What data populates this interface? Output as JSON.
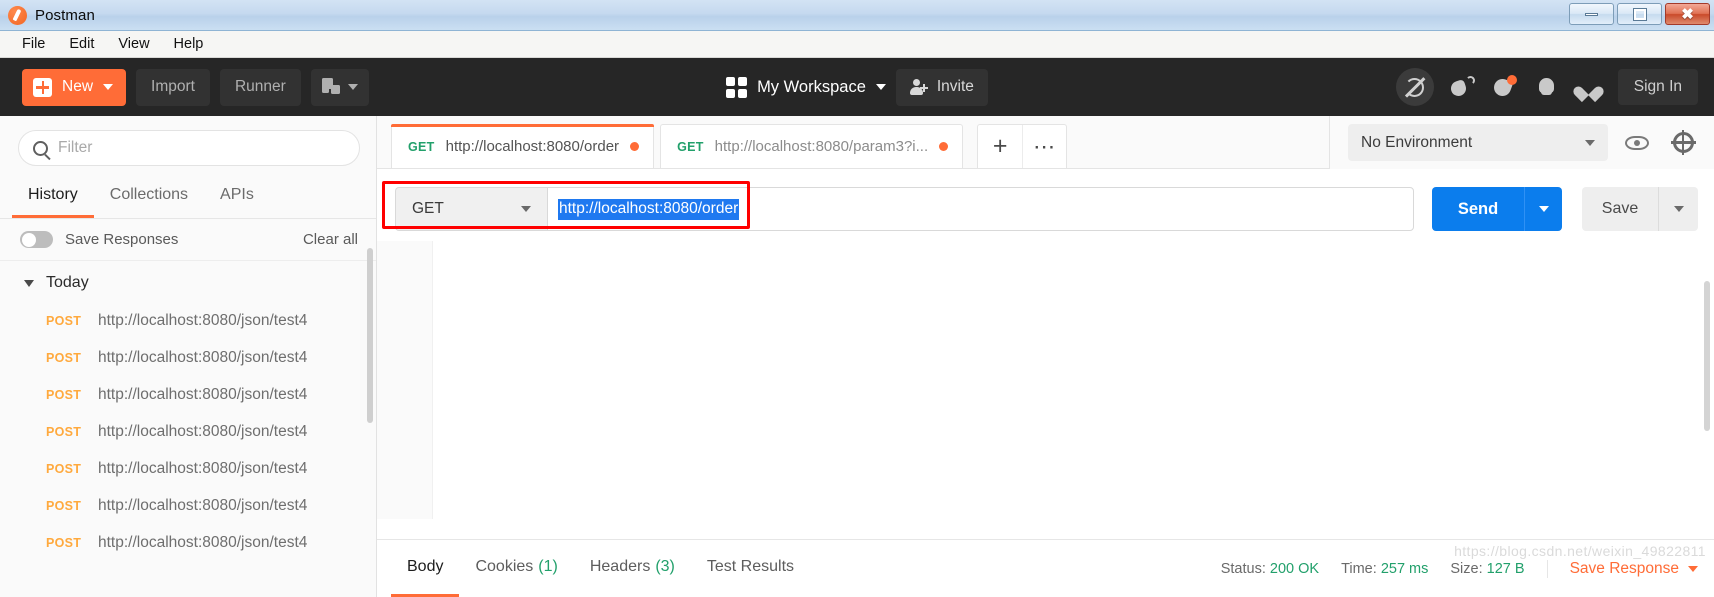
{
  "window": {
    "title": "Postman",
    "logo_icon": "postman-logo-icon",
    "minimize_icon": "minimize-icon",
    "maximize_icon": "maximize-icon",
    "close_icon": "close-icon"
  },
  "menubar": {
    "items": [
      {
        "label": "File"
      },
      {
        "label": "Edit"
      },
      {
        "label": "View"
      },
      {
        "label": "Help"
      }
    ]
  },
  "toolbar": {
    "new_label": "New",
    "new_icon": "plus-square-icon",
    "new_caret_icon": "chevron-down-icon",
    "import_label": "Import",
    "runner_label": "Runner",
    "open_new_icon": "new-window-icon",
    "open_new_caret_icon": "chevron-down-icon",
    "workspace_icon": "grid-icon",
    "workspace_label": "My Workspace",
    "workspace_caret_icon": "chevron-down-icon",
    "invite_label": "Invite",
    "invite_icon": "person-plus-icon",
    "sync_icon": "sync-off-icon",
    "satellite_icon": "satellite-dish-icon",
    "wrench_icon": "wrench-icon",
    "bell_icon": "bell-icon",
    "heart_icon": "heart-icon",
    "signin_label": "Sign In"
  },
  "sidebar": {
    "search": {
      "placeholder": "Filter",
      "value": "",
      "icon": "search-icon"
    },
    "tabs": [
      {
        "label": "History",
        "active": true
      },
      {
        "label": "Collections",
        "active": false
      },
      {
        "label": "APIs",
        "active": false
      }
    ],
    "save_responses_label": "Save Responses",
    "save_responses_on": false,
    "clear_all_label": "Clear all",
    "group_label": "Today",
    "group_caret_icon": "triangle-down-icon",
    "history": [
      {
        "method": "POST",
        "url": "http://localhost:8080/json/test4"
      },
      {
        "method": "POST",
        "url": "http://localhost:8080/json/test4"
      },
      {
        "method": "POST",
        "url": "http://localhost:8080/json/test4"
      },
      {
        "method": "POST",
        "url": "http://localhost:8080/json/test4"
      },
      {
        "method": "POST",
        "url": "http://localhost:8080/json/test4"
      },
      {
        "method": "POST",
        "url": "http://localhost:8080/json/test4"
      },
      {
        "method": "POST",
        "url": "http://localhost:8080/json/test4"
      }
    ]
  },
  "request_tabs": {
    "items": [
      {
        "method": "GET",
        "url": "http://localhost:8080/order",
        "active": true,
        "unsaved": true
      },
      {
        "method": "GET",
        "url": "http://localhost:8080/param3?i...",
        "active": false,
        "unsaved": true
      }
    ],
    "new_tab_icon": "plus-icon",
    "more_icon": "ellipsis-icon"
  },
  "environment": {
    "selected": "No Environment",
    "caret_icon": "chevron-down-icon",
    "eye_icon": "eye-icon",
    "gear_icon": "gear-icon"
  },
  "request": {
    "method": "GET",
    "method_caret_icon": "chevron-down-icon",
    "url": "http://localhost:8080/order",
    "url_selected": true,
    "send_label": "Send",
    "send_caret_icon": "chevron-down-icon",
    "save_label": "Save",
    "save_caret_icon": "chevron-down-icon",
    "highlight_color": "#ff0000"
  },
  "response": {
    "tabs": [
      {
        "label": "Body",
        "count": "",
        "active": true
      },
      {
        "label": "Cookies",
        "count": "(1)",
        "active": false
      },
      {
        "label": "Headers",
        "count": "(3)",
        "active": false
      },
      {
        "label": "Test Results",
        "count": "",
        "active": false
      }
    ],
    "status_label": "Status:",
    "status_value": "200 OK",
    "time_label": "Time:",
    "time_value": "257 ms",
    "size_label": "Size:",
    "size_value": "127 B",
    "save_response_label": "Save Response",
    "save_response_caret_icon": "chevron-down-icon",
    "watermark": "https://blog.csdn.net/weixin_49822811"
  },
  "colors": {
    "accent_orange": "#ff6c37",
    "send_blue": "#0b7ded",
    "status_green": "#22a06b",
    "method_post": "#ffa93d",
    "highlight_red": "#ff0000",
    "selection_blue": "#1f79f0"
  }
}
